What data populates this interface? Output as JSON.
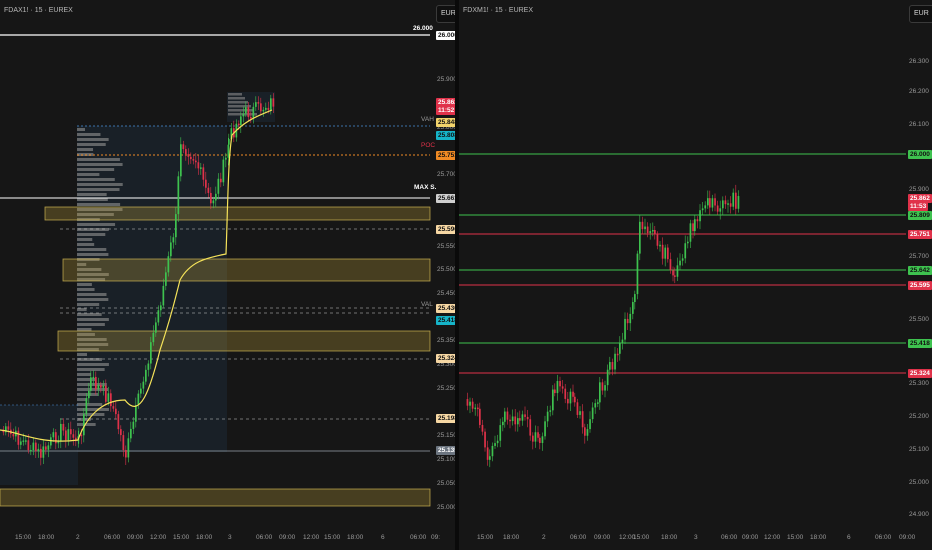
{
  "left_chart": {
    "title": "FDAX1! · 15 · EUREX",
    "currency": "EUR",
    "price_scale": [
      "25.900",
      "25.800",
      "25.700",
      "25.650",
      "25.550",
      "25.500",
      "25.450",
      "25.350",
      "25.300",
      "25.250",
      "25.150",
      "25.100",
      "25.050",
      "25.000"
    ],
    "time_scale": [
      "15:00",
      "18:00",
      "2",
      "06:00",
      "09:00",
      "12:00",
      "15:00",
      "18:00",
      "3",
      "06:00",
      "09:00",
      "12:00",
      "15:00",
      "18:00",
      "6",
      "06:00",
      "09:"
    ],
    "price_tags": [
      {
        "text": "26.000",
        "bg": "#ffffff",
        "fg": "#111111"
      },
      {
        "text": "25.862",
        "bg": "#e0324a",
        "fg": "#ffffff"
      },
      {
        "text": "11:52",
        "bg": "#e0324a",
        "fg": "#ffffff"
      },
      {
        "text": "25.848",
        "bg": "#f2d36b",
        "fg": "#111111"
      },
      {
        "text": "25.808",
        "bg": "#16b4c8",
        "fg": "#111111"
      },
      {
        "text": "25.751",
        "bg": "#f08a24",
        "fg": "#111111"
      },
      {
        "text": "25.661",
        "bg": "#cfcfcf",
        "fg": "#111111"
      },
      {
        "text": "25.596",
        "bg": "#f6d7a3",
        "fg": "#111111"
      },
      {
        "text": "25.430",
        "bg": "#f6d7a3",
        "fg": "#111111"
      },
      {
        "text": "25.418",
        "bg": "#16b4c8",
        "fg": "#111111"
      },
      {
        "text": "25.324",
        "bg": "#f6d7a3",
        "fg": "#111111"
      },
      {
        "text": "25.198",
        "bg": "#f6d7a3",
        "fg": "#111111"
      },
      {
        "text": "25.135",
        "bg": "#6c7580",
        "fg": "#ffffff"
      }
    ],
    "labels": {
      "top_line": "26.000",
      "vah": "VAH",
      "poc": "POC",
      "max": "MAX S.",
      "val": "VAL"
    }
  },
  "right_chart": {
    "title": "FDXM1! · 15 · EUREX",
    "currency": "EUR",
    "price_scale": [
      "26.300",
      "26.200",
      "26.100",
      "25.900",
      "25.700",
      "25.500",
      "25.300",
      "25.200",
      "25.100",
      "25.000",
      "24.900"
    ],
    "time_scale": [
      "15:00",
      "18:00",
      "2",
      "06:00",
      "09:00",
      "12:00",
      "15:00",
      "18:00",
      "3",
      "06:00",
      "09:00",
      "12:00",
      "15:00",
      "18:00",
      "6",
      "06:00",
      "09:00"
    ],
    "price_tags": [
      {
        "text": "26.000",
        "bg": "#3ec24f",
        "fg": "#111111"
      },
      {
        "text": "25.862",
        "bg": "#e0324a",
        "fg": "#ffffff"
      },
      {
        "text": "11:53",
        "bg": "#e0324a",
        "fg": "#ffffff"
      },
      {
        "text": "25.809",
        "bg": "#3ec24f",
        "fg": "#111111"
      },
      {
        "text": "25.751",
        "bg": "#e0324a",
        "fg": "#ffffff"
      },
      {
        "text": "25.642",
        "bg": "#3ec24f",
        "fg": "#111111"
      },
      {
        "text": "25.595",
        "bg": "#e0324a",
        "fg": "#ffffff"
      },
      {
        "text": "25.418",
        "bg": "#3ec24f",
        "fg": "#111111"
      },
      {
        "text": "25.324",
        "bg": "#e0324a",
        "fg": "#ffffff"
      }
    ]
  }
}
